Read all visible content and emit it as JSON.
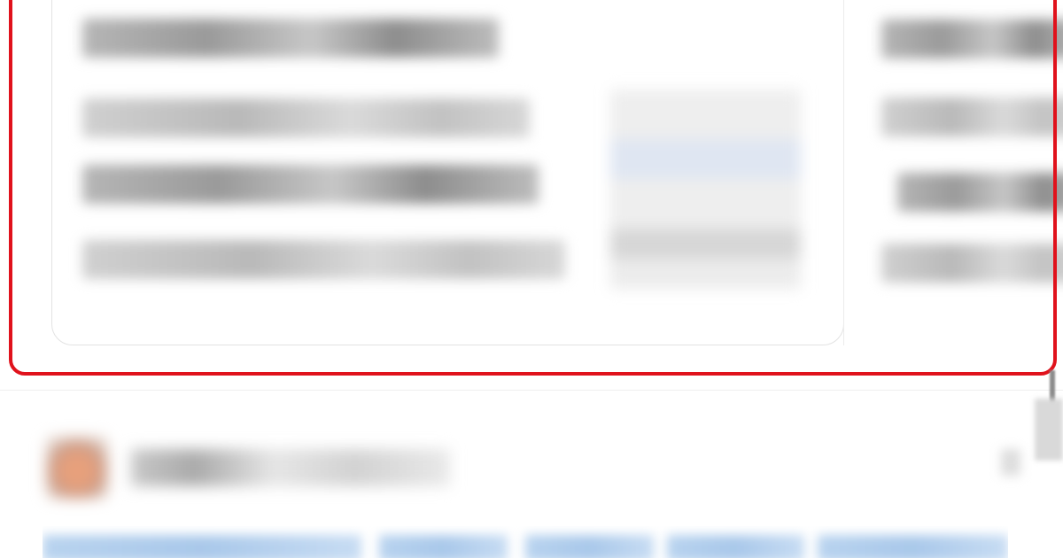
{
  "window": {
    "title": ""
  },
  "carousel": {
    "card": {
      "title": "",
      "lines": [
        "",
        "",
        ""
      ]
    },
    "next_card": {
      "title": "",
      "lines": [
        "",
        "",
        ""
      ]
    }
  },
  "post": {
    "author": "",
    "link_text": ""
  },
  "colors": {
    "highlight": "#e0121c",
    "link": "#a9c8ea",
    "avatar": "#e7a07c"
  }
}
